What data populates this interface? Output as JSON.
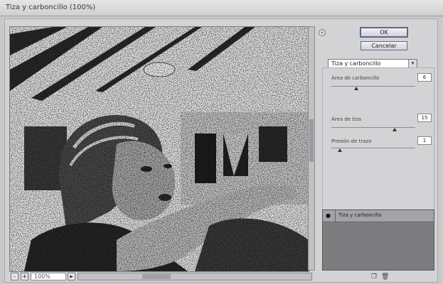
{
  "window": {
    "title": "Tiza y carboncillo (100%)"
  },
  "zoom": {
    "minus": "-",
    "plus": "+",
    "value": "100%"
  },
  "buttons": {
    "ok": "OK",
    "cancel": "Cancelar",
    "collapse": "«"
  },
  "filter": {
    "selected": "Tiza y carboncillo",
    "arrow": "▾"
  },
  "params": [
    {
      "label": "Área de carboncillo",
      "value": "6",
      "slider": 0.3
    },
    {
      "label": "Área de tiza",
      "value": "15",
      "slider": 0.75
    },
    {
      "label": "Presión de trazo",
      "value": "1",
      "slider": 0.1
    }
  ],
  "layers": [
    {
      "name": "Tiza y carboncillo",
      "visible": "●"
    }
  ],
  "bottom_icons": {
    "new": "❐",
    "delete": "🗑"
  }
}
